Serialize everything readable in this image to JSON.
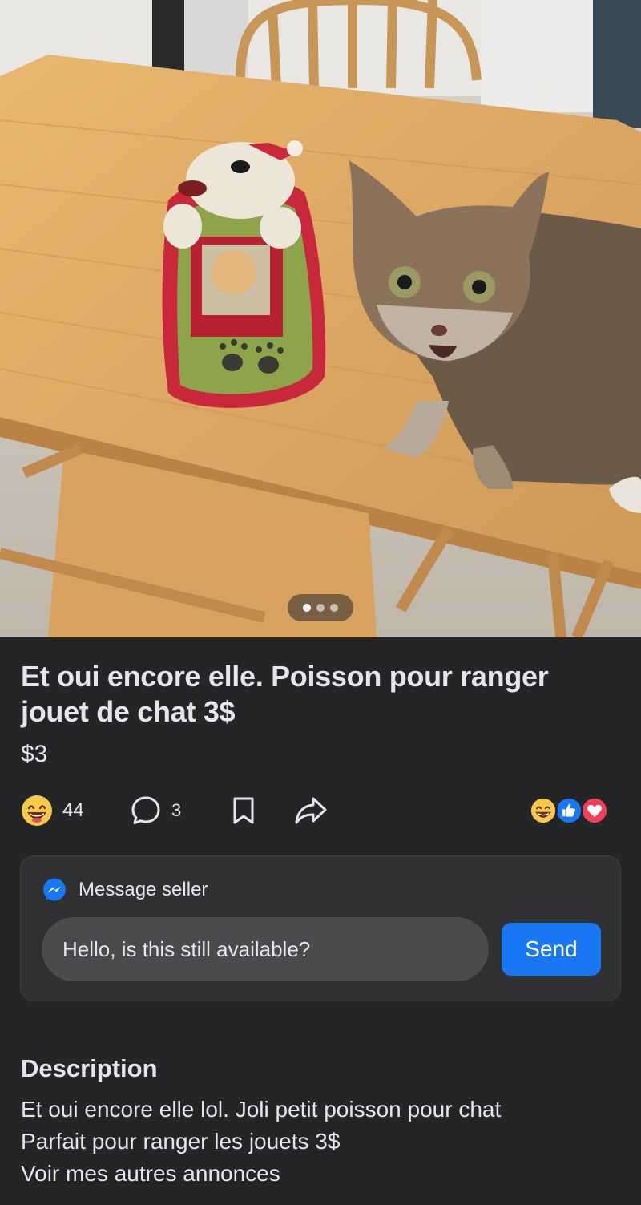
{
  "listing": {
    "title": "Et oui encore elle. Poisson pour ranger jouet de chat 3$",
    "price": "$3",
    "photo_pager": {
      "total": 3,
      "active": 1
    }
  },
  "actions": {
    "reaction_count": "44",
    "comment_count": "3",
    "icons": [
      "grinning-emoji-icon",
      "comment-icon",
      "bookmark-icon",
      "share-icon"
    ],
    "reaction_icons": [
      "grinning-emoji-icon",
      "like-icon",
      "love-icon"
    ]
  },
  "message": {
    "header": "Message seller",
    "input_value": "Hello, is this still available?",
    "send_label": "Send"
  },
  "description": {
    "heading": "Description",
    "lines": [
      "Et oui encore elle lol. Joli petit poisson pour chat",
      "Parfait pour ranger les jouets 3$",
      "Voir mes autres annonces"
    ]
  },
  "colors": {
    "background": "#242526",
    "card": "#2f3031",
    "accent": "#1877f2",
    "text": "#e4e6eb"
  }
}
